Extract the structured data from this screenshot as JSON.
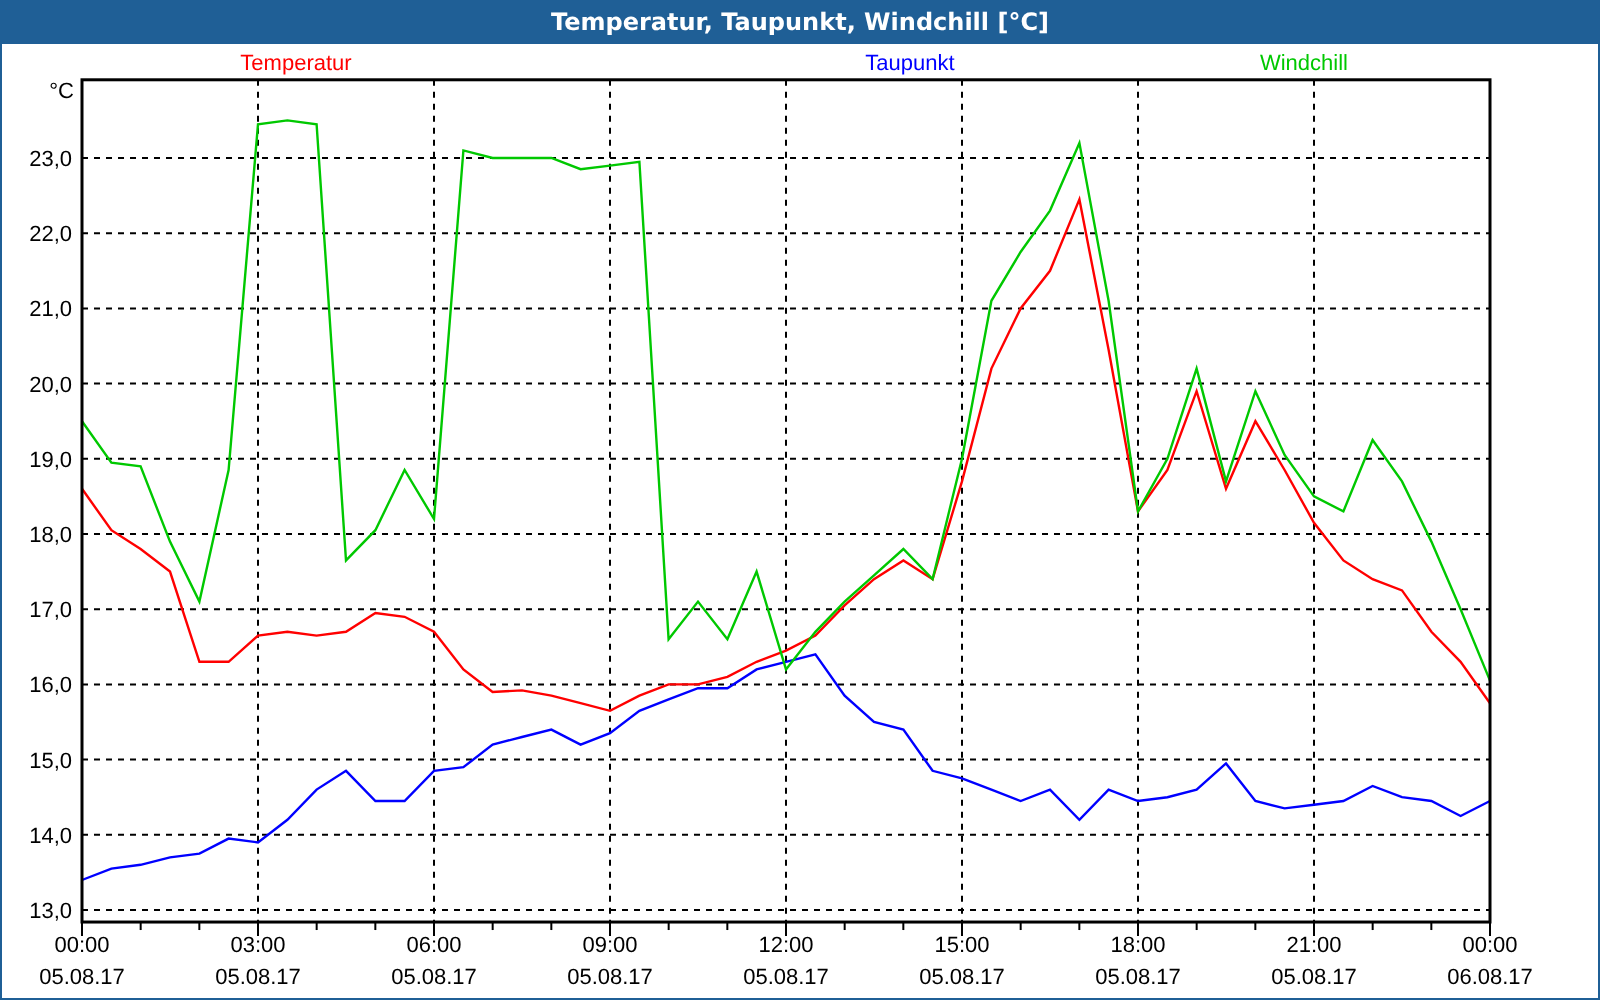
{
  "window": {
    "title": "Temperatur, Taupunkt, Windchill [°C]"
  },
  "chart": {
    "chart_data": {
      "type": "line",
      "grid": true,
      "ylabel": "°C",
      "ylim": [
        12.84,
        24.04
      ],
      "categories": [
        "00:00 05.08.17",
        null,
        null,
        null,
        null,
        null,
        "03:00 05.08.17",
        null,
        null,
        null,
        null,
        null,
        "06:00 05.08.17",
        null,
        null,
        null,
        null,
        null,
        "09:00 05.08.17",
        null,
        null,
        null,
        null,
        null,
        "12:00 05.08.17",
        null,
        null,
        null,
        null,
        null,
        "15:00 05.08.17",
        null,
        null,
        null,
        null,
        null,
        "18:00 05.08.17",
        null,
        null,
        null,
        null,
        null,
        "21:00 05.08.17",
        null,
        null,
        null,
        null,
        null,
        "00:00 06.08.17"
      ],
      "yticks": [
        {
          "value": 13,
          "label": "13,0"
        },
        {
          "value": 14,
          "label": "14,0"
        },
        {
          "value": 15,
          "label": "15,0"
        },
        {
          "value": 16,
          "label": "16,0"
        },
        {
          "value": 17,
          "label": "17,0"
        },
        {
          "value": 18,
          "label": "18,0"
        },
        {
          "value": 19,
          "label": "19,0"
        },
        {
          "value": 20,
          "label": "20,0"
        },
        {
          "value": 21,
          "label": "21,0"
        },
        {
          "value": 22,
          "label": "22,0"
        },
        {
          "value": 23,
          "label": "23,0"
        }
      ],
      "series": [
        {
          "name": "Temperatur",
          "color": "#ff0000",
          "values": [
            18.6,
            18.05,
            17.8,
            17.5,
            16.3,
            16.3,
            16.65,
            16.7,
            16.65,
            16.7,
            16.95,
            16.9,
            16.7,
            16.2,
            15.9,
            15.92,
            15.85,
            15.75,
            15.65,
            15.85,
            16.0,
            16.0,
            16.1,
            16.3,
            16.45,
            16.65,
            17.05,
            17.4,
            17.65,
            17.4,
            18.7,
            20.2,
            21.0,
            21.5,
            22.45,
            20.45,
            18.3,
            18.85,
            19.9,
            18.6,
            19.5,
            18.85,
            18.15,
            17.65,
            17.4,
            17.25,
            16.7,
            16.3,
            15.75
          ]
        },
        {
          "name": "Taupunkt",
          "color": "#0000ff",
          "values": [
            13.4,
            13.55,
            13.6,
            13.7,
            13.75,
            13.95,
            13.9,
            14.2,
            14.6,
            14.85,
            14.45,
            14.45,
            14.85,
            14.9,
            15.2,
            15.3,
            15.4,
            15.2,
            15.35,
            15.65,
            15.8,
            15.95,
            15.95,
            16.2,
            16.3,
            16.4,
            15.85,
            15.5,
            15.4,
            14.85,
            14.75,
            14.6,
            14.45,
            14.6,
            14.2,
            14.6,
            14.45,
            14.5,
            14.6,
            14.95,
            14.45,
            14.35,
            14.4,
            14.45,
            14.65,
            14.5,
            14.45,
            14.25,
            14.45
          ]
        },
        {
          "name": "Windchill",
          "color": "#00c800",
          "values": [
            19.5,
            18.95,
            18.9,
            17.9,
            17.1,
            18.85,
            23.45,
            23.5,
            23.45,
            17.65,
            18.05,
            18.85,
            18.2,
            23.1,
            23.0,
            23.0,
            23.0,
            22.85,
            22.9,
            22.95,
            16.6,
            17.1,
            16.6,
            17.5,
            16.2,
            16.7,
            17.1,
            17.45,
            17.8,
            17.4,
            19.0,
            21.1,
            21.75,
            22.3,
            23.2,
            21.1,
            18.3,
            19.0,
            20.2,
            18.7,
            19.9,
            19.05,
            18.5,
            18.3,
            19.25,
            18.7,
            17.9,
            17.0,
            16.05
          ]
        }
      ]
    }
  }
}
